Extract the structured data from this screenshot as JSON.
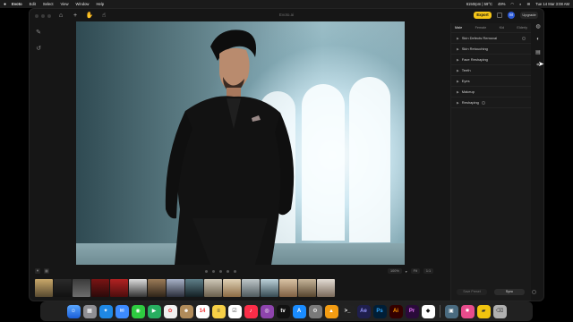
{
  "menubar": {
    "apple": "",
    "menus": [
      "Evoto",
      "Edit",
      "Select",
      "View",
      "Window",
      "Help"
    ],
    "status": [
      "6150rpm | 59°C",
      "49%",
      "Tue 14 Mar 3:08 AM"
    ]
  },
  "window": {
    "title": "Evoto.ai",
    "export_label": "Export",
    "avatar_initial": "M",
    "upgrade_label": "Upgrade"
  },
  "panel": {
    "tabs": [
      "Male",
      "Female",
      "Kid",
      "Elderly"
    ],
    "active_tab": "Male",
    "sections": [
      {
        "label": "Skin Defects Removal"
      },
      {
        "label": "Skin Retouching"
      },
      {
        "label": "Face Reshaping"
      },
      {
        "label": "Teeth"
      },
      {
        "label": "Eyes"
      },
      {
        "label": "Makeup"
      },
      {
        "label": "Reshaping"
      }
    ],
    "save_preset_label": "Save Preset",
    "sync_label": "Sync"
  },
  "bottombar": {
    "zoom": "100%",
    "fit_label": "Fit",
    "ratio_label": "1:1"
  },
  "colors": {
    "accent": "#f5c518",
    "bg": "#161616",
    "panel": "#1a1a1a"
  },
  "dock": {
    "apps": [
      "Finder",
      "Launchpad",
      "Safari",
      "Mail",
      "Messages",
      "FaceTime",
      "Photos",
      "Contacts",
      "Calendar",
      "Notes",
      "Reminders",
      "Music",
      "Podcasts",
      "TV",
      "App Store",
      "System Settings",
      "VLC",
      "Terminal",
      "Ae",
      "Ps",
      "Ai",
      "Pr",
      "Evoto",
      "Preview",
      "Downloads",
      "Trash"
    ]
  }
}
